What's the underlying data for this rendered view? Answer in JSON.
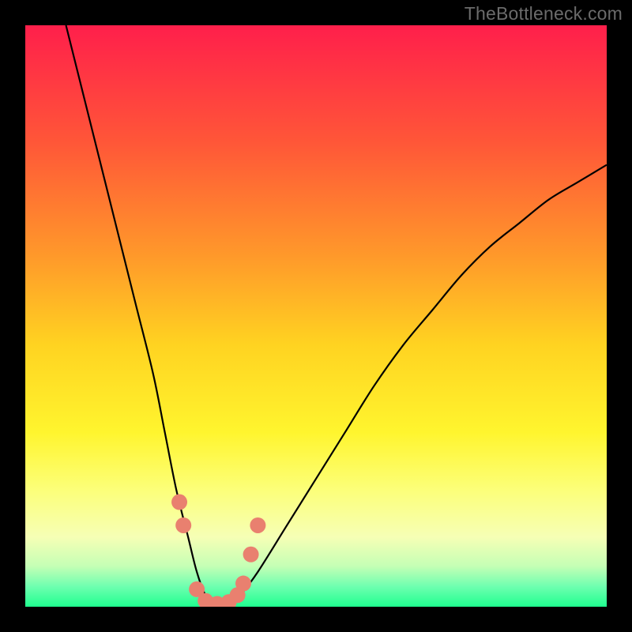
{
  "watermark": "TheBottleneck.com",
  "chart_data": {
    "type": "line",
    "title": "",
    "xlabel": "",
    "ylabel": "",
    "xlim": [
      0,
      100
    ],
    "ylim": [
      0,
      100
    ],
    "plot_background_gradient": {
      "type": "vertical",
      "stops": [
        {
          "pos": 0.0,
          "color": "#ff1f4b"
        },
        {
          "pos": 0.2,
          "color": "#ff5638"
        },
        {
          "pos": 0.4,
          "color": "#ff9a2a"
        },
        {
          "pos": 0.55,
          "color": "#ffd321"
        },
        {
          "pos": 0.7,
          "color": "#fff52e"
        },
        {
          "pos": 0.8,
          "color": "#fcff7a"
        },
        {
          "pos": 0.88,
          "color": "#f6ffb5"
        },
        {
          "pos": 0.93,
          "color": "#c5ffb5"
        },
        {
          "pos": 0.965,
          "color": "#6fffb0"
        },
        {
          "pos": 1.0,
          "color": "#1fff8f"
        }
      ]
    },
    "series": [
      {
        "name": "bottleneck-curve",
        "color": "#000000",
        "x": [
          7,
          10,
          13,
          16,
          19,
          22,
          24,
          26,
          28,
          29.5,
          31,
          33,
          35,
          37,
          40,
          45,
          50,
          55,
          60,
          65,
          70,
          75,
          80,
          85,
          90,
          95,
          100
        ],
        "y": [
          100,
          88,
          76,
          64,
          52,
          40,
          30,
          20,
          12,
          6,
          2,
          0,
          0,
          2,
          6,
          14,
          22,
          30,
          38,
          45,
          51,
          57,
          62,
          66,
          70,
          73,
          76
        ]
      }
    ],
    "markers": {
      "name": "highlight-points",
      "color": "#e9806f",
      "radius_px": 10,
      "points": [
        {
          "x": 26.5,
          "y": 18
        },
        {
          "x": 27.2,
          "y": 14
        },
        {
          "x": 29.5,
          "y": 3
        },
        {
          "x": 31.0,
          "y": 1
        },
        {
          "x": 33.0,
          "y": 0.5
        },
        {
          "x": 35.0,
          "y": 0.8
        },
        {
          "x": 36.5,
          "y": 2
        },
        {
          "x": 37.5,
          "y": 4
        },
        {
          "x": 38.8,
          "y": 9
        },
        {
          "x": 40.0,
          "y": 14
        }
      ]
    }
  }
}
